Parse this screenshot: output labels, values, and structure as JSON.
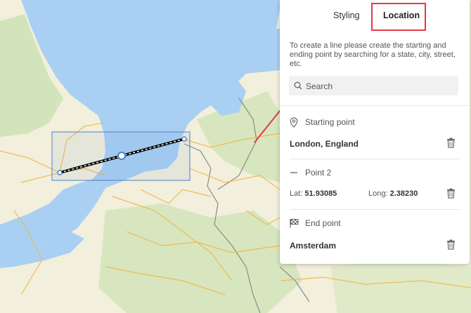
{
  "tabs": [
    {
      "label": "Styling",
      "active": false
    },
    {
      "label": "Location",
      "active": true
    }
  ],
  "intro_text": "To create a line please create the starting and ending point by searching for a state, city, street, etc.",
  "search": {
    "placeholder": "Search",
    "value": ""
  },
  "points": {
    "start": {
      "heading": "Starting point",
      "icon": "map-pin-icon",
      "value": "London, England"
    },
    "point2": {
      "heading": "Point 2",
      "icon": "dash-icon",
      "lat_label": "Lat:",
      "lat_value": "51.93085",
      "long_label": "Long:",
      "long_value": "2.38230"
    },
    "end": {
      "heading": "End point",
      "icon": "checkered-flag-icon",
      "value": "Amsterdam"
    }
  },
  "colors": {
    "highlight": "#e53946",
    "accent": "#4a80c8",
    "water": "#a9d0f2",
    "land": "#f2efd9"
  }
}
